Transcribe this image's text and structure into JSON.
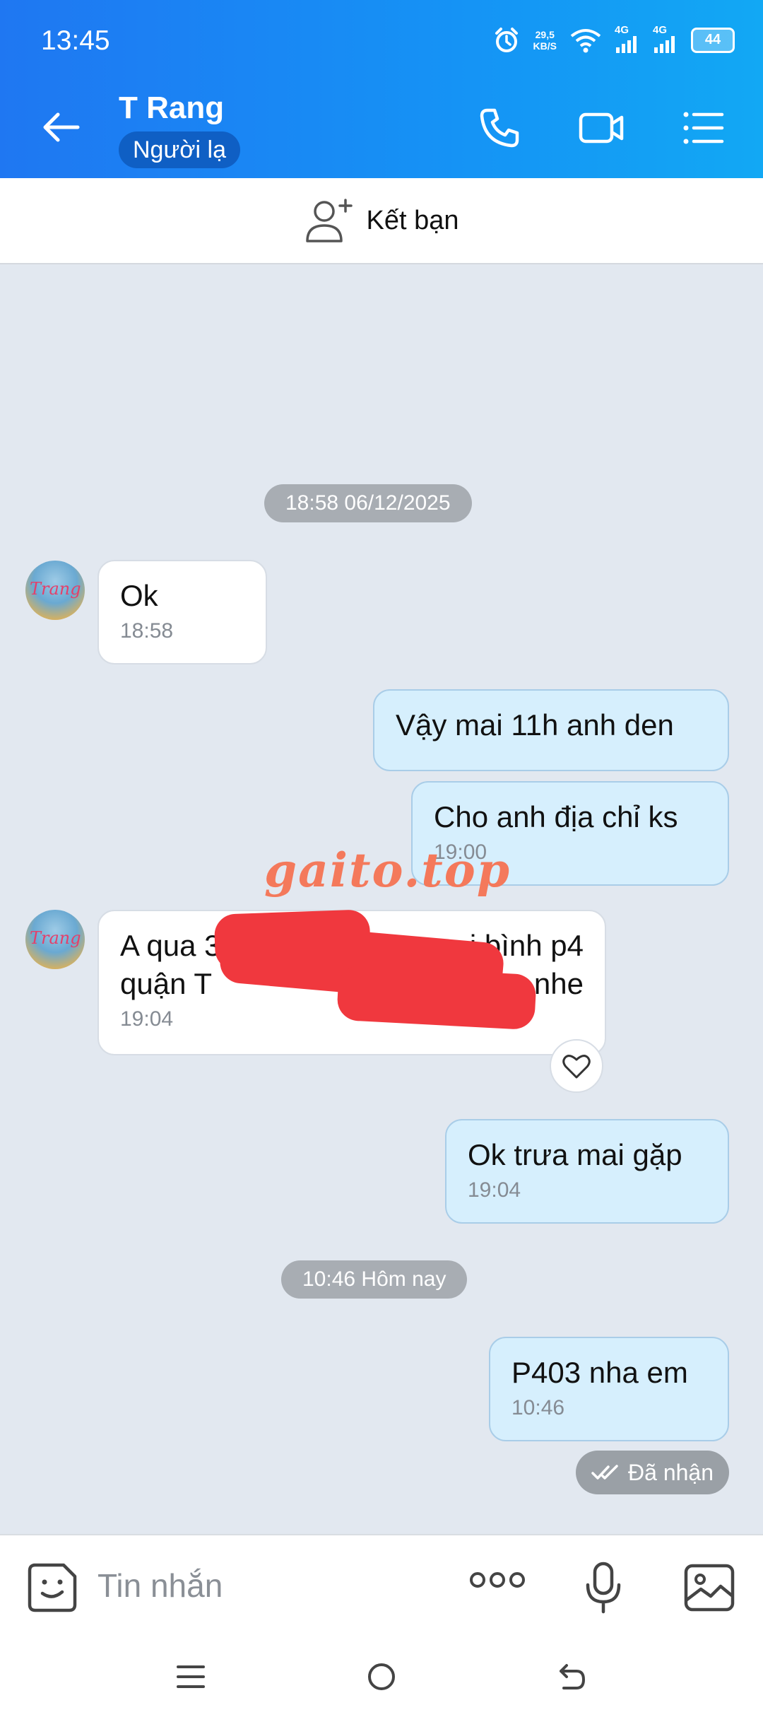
{
  "status_bar": {
    "time": "13:45",
    "net_speed_value": "29,5",
    "net_speed_unit": "KB/S",
    "signal1_label": "4G",
    "signal2_label": "4G",
    "battery": "44"
  },
  "header": {
    "contact_name": "T Rang",
    "badge": "Người lạ",
    "colors": {
      "gradient_start": "#1f77f2",
      "gradient_end": "#12a8f4"
    }
  },
  "add_friend": {
    "label": "Kết bạn"
  },
  "conversation": {
    "date_separator_1": "18:58 06/12/2025",
    "msg1": {
      "text": "Ok",
      "time": "18:58"
    },
    "msg2": {
      "text": "Vậy mai 11h anh den"
    },
    "msg3": {
      "text": "Cho anh địa chỉ ks",
      "time": "19:00"
    },
    "msg4": {
      "line1": "A qua 3",
      "line1_end": "i bình p4",
      "line2": "quận T",
      "line2_end": "nhe",
      "time": "19:04"
    },
    "msg5": {
      "text": "Ok trưa mai gặp",
      "time": "19:04"
    },
    "date_separator_2": "10:46 Hôm nay",
    "msg6": {
      "text": "P403 nha em",
      "time": "10:46"
    },
    "received_status": "Đã nhận"
  },
  "avatar_label": "Trang",
  "watermark": "gaito.top",
  "input_bar": {
    "placeholder": "Tin nhắn"
  }
}
